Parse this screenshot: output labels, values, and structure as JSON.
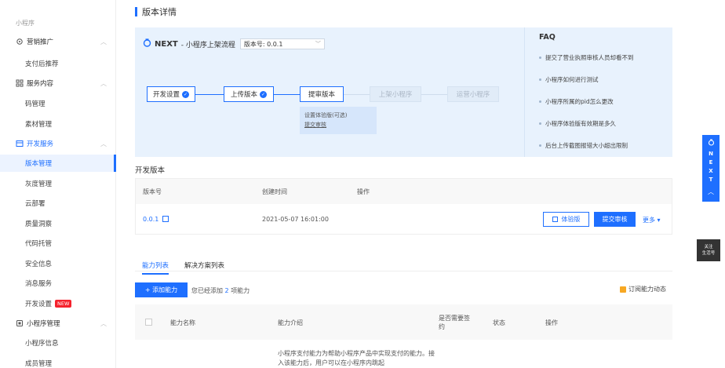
{
  "sidebar": {
    "heading": "小程序",
    "groups": [
      {
        "label": "营销推广",
        "items": [
          "支付后推荐"
        ]
      },
      {
        "label": "服务内容",
        "items": [
          "码管理",
          "素材管理"
        ]
      },
      {
        "label": "开发服务",
        "items": [
          "版本管理",
          "灰度管理",
          "云部署",
          "质量洞察",
          "代码托管",
          "安全信息",
          "消息服务",
          "开发设置"
        ]
      },
      {
        "label": "小程序管理",
        "items": [
          "小程序信息",
          "成员管理"
        ]
      }
    ],
    "new_badge": "NEW"
  },
  "page": {
    "title": "版本详情"
  },
  "flow": {
    "brand": "NEXT",
    "subtitle": "- 小程序上架流程",
    "version_select": "版本号: 0.0.1",
    "steps": [
      "开发设置",
      "上传版本",
      "提审版本",
      "上架小程序",
      "运营小程序"
    ],
    "substeps": [
      "设置体验版(可选)",
      "提交审核"
    ]
  },
  "faq": {
    "title": "FAQ",
    "items": [
      "提交了营业执照审核人员却看不到",
      "小程序如何进行测试",
      "小程序所属的pid怎么更改",
      "小程序体验版有效期是多久",
      "后台上传截图报错大小超出限制"
    ]
  },
  "dev_version": {
    "section_title": "开发版本",
    "headers": [
      "版本号",
      "创建时间",
      "操作"
    ],
    "row": {
      "version": "0.0.1",
      "created": "2021-05-07 16:01:00"
    },
    "trial_btn": "体验版",
    "submit_btn": "提交审核",
    "more": "更多"
  },
  "capability": {
    "tabs": [
      "能力列表",
      "解决方案列表"
    ],
    "add_btn": "+ 添加能力",
    "added_prefix": "您已经添加",
    "added_count": "2",
    "added_suffix": "项能力",
    "subscribe": "订阅能力动态",
    "headers": [
      "能力名称",
      "能力介绍",
      "是否需要签约",
      "状态",
      "操作"
    ],
    "row_desc": "小程序支付能力为帮助小程序产品中实现支付的能力。接入该能力后，用户可以在小程序内跳起"
  },
  "floating": {
    "next_letters": [
      "N",
      "E",
      "X",
      "T"
    ],
    "follow_line1": "关注",
    "follow_line2": "生活号"
  }
}
